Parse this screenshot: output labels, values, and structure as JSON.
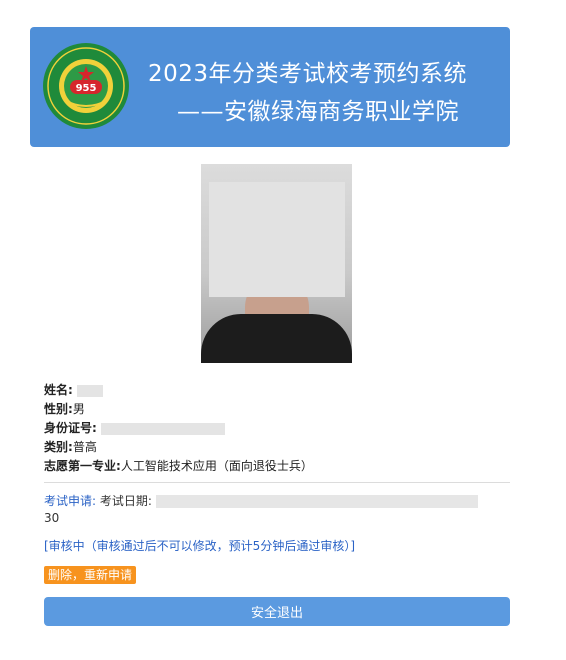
{
  "header": {
    "title": "2023年分类考试校考预约系统",
    "subtitle": "——安徽绿海商务职业学院",
    "logo_number": "955",
    "logo_text_top": "安徽绿海商务职业学院",
    "logo_text_bottom": "ANHUI LVHAI COLLEGE OF BUSINESS"
  },
  "profile": {
    "name_label": "姓名:",
    "gender_label": "性别:",
    "gender_value": "男",
    "id_label": "身份证号:",
    "category_label": "类别:",
    "category_value": "普高",
    "major_label": "志愿第一专业:",
    "major_value": "人工智能技术应用（面向退役士兵）"
  },
  "appointment": {
    "tag": "考试申请:",
    "date_label": "考试日期:",
    "time_tail": "30",
    "status": "[审核中（审核通过后不可以修改，预计5分钟后通过审核）]"
  },
  "actions": {
    "redo_label": "删除，重新申请",
    "exit_label": "安全退出"
  },
  "colors": {
    "banner": "#4f8fd8",
    "link": "#2b63c6",
    "redo_button": "#f7931e",
    "exit_button": "#5b9ae0"
  }
}
